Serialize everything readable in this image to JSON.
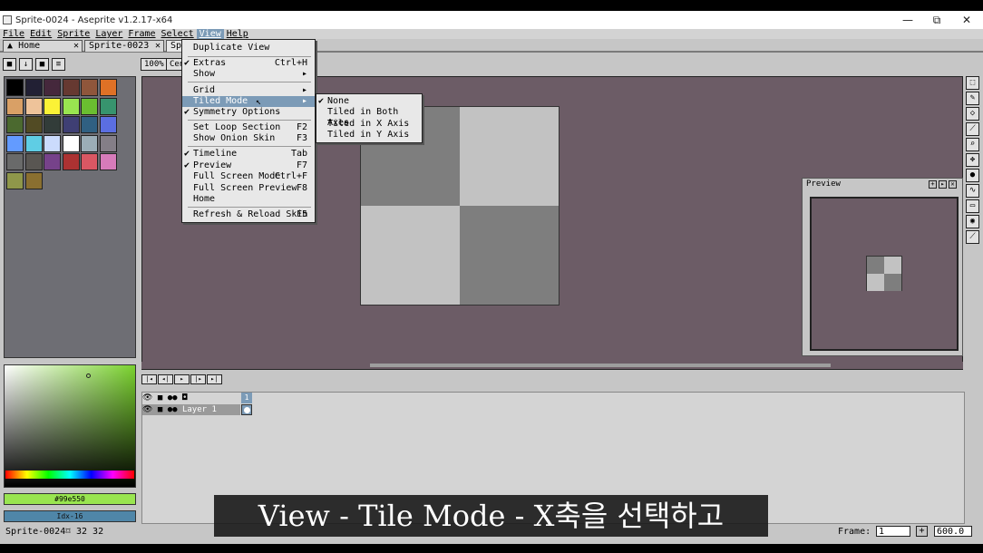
{
  "window": {
    "title": "Sprite-0024 - Aseprite v1.2.17-x64",
    "minimize": "—",
    "maximize": "⧉",
    "close": "✕"
  },
  "menubar": [
    "File",
    "Edit",
    "Sprite",
    "Layer",
    "Frame",
    "Select",
    "View",
    "Help"
  ],
  "tabs": [
    {
      "label": "Home",
      "close": "✕"
    },
    {
      "label": "Sprite-0023",
      "close": "✕"
    },
    {
      "label": "Sp",
      "close": ""
    }
  ],
  "toolbar": {
    "zoom": "100%",
    "center": "Cen"
  },
  "palette": {
    "colors": [
      "#000000",
      "#222034",
      "#45283c",
      "#663931",
      "#8f563b",
      "#df7126",
      "#d9a066",
      "#eec39a",
      "#fbf236",
      "#99e550",
      "#6abe30",
      "#37946e",
      "#4b692f",
      "#524b24",
      "#323c39",
      "#3f3f74",
      "#306082",
      "#5b6ee1",
      "#639bff",
      "#5fcde4",
      "#cbdbfc",
      "#ffffff",
      "#9badb7",
      "#847e87",
      "#696a6a",
      "#595652",
      "#76428a",
      "#ac3232",
      "#d95763",
      "#d77bba",
      "#8f974a",
      "#8a6f30"
    ]
  },
  "color": {
    "hex": "#99e550",
    "index": "Idx-16"
  },
  "view_menu": {
    "items": [
      {
        "label": "Duplicate View",
        "shortcut": "",
        "check": ""
      },
      {
        "label": "Extras",
        "shortcut": "Ctrl+H",
        "check": "✔"
      },
      {
        "label": "Show",
        "shortcut": "▸",
        "check": ""
      },
      {
        "label": "Grid",
        "shortcut": "▸",
        "check": ""
      },
      {
        "label": "Tiled Mode",
        "shortcut": "▸",
        "check": ""
      },
      {
        "label": "Symmetry Options",
        "shortcut": "",
        "check": "✔"
      },
      {
        "label": "Set Loop Section",
        "shortcut": "F2",
        "check": ""
      },
      {
        "label": "Show Onion Skin",
        "shortcut": "F3",
        "check": ""
      },
      {
        "label": "Timeline",
        "shortcut": "Tab",
        "check": "✔"
      },
      {
        "label": "Preview",
        "shortcut": "F7",
        "check": "✔"
      },
      {
        "label": "Full Screen Mode",
        "shortcut": "Ctrl+F",
        "check": ""
      },
      {
        "label": "Full Screen Preview",
        "shortcut": "F8",
        "check": ""
      },
      {
        "label": "Home",
        "shortcut": "",
        "check": ""
      },
      {
        "label": "Refresh & Reload Skin",
        "shortcut": "F5",
        "check": ""
      }
    ]
  },
  "tiled_submenu": {
    "items": [
      {
        "label": "None",
        "check": "✔"
      },
      {
        "label": "Tiled in Both Axes",
        "check": ""
      },
      {
        "label": "Tiled in X Axis",
        "check": ""
      },
      {
        "label": "Tiled in Y Axis",
        "check": ""
      }
    ]
  },
  "preview": {
    "title": "Preview"
  },
  "timeline": {
    "frame_number": "1",
    "layer_name": "Layer 1"
  },
  "status": {
    "sprite": "Sprite-0024",
    "size": "32 32",
    "frame_label": "Frame:",
    "frame_value": "1",
    "zoom_value": "600.0"
  },
  "subtitle": "View - Tile Mode - X축을 선택하고"
}
